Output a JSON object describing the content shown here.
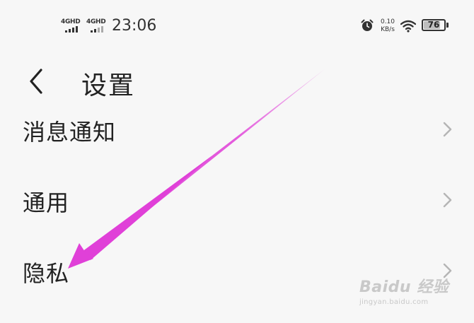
{
  "status_bar": {
    "signal_1_label": "4GHD",
    "signal_2_label": "4GHD",
    "time": "23:06",
    "net_speed_value": "0.10",
    "net_speed_unit": "KB/s",
    "battery_level": "76",
    "battery_fraction": 0.76,
    "icons": [
      "alarm-clock-icon",
      "wifi-icon",
      "battery-icon",
      "signal-icon"
    ]
  },
  "header": {
    "title": "设置",
    "back_icon": "chevron-left-icon"
  },
  "menu": {
    "items": [
      {
        "label": "消息通知",
        "icon": "chevron-right-icon"
      },
      {
        "label": "通用",
        "icon": "chevron-right-icon"
      },
      {
        "label": "隐私",
        "icon": "chevron-right-icon"
      }
    ]
  },
  "annotation": {
    "arrow_color": "#e040d8",
    "arrow_target": "隐私"
  },
  "watermark": {
    "main": "Baidu 经验",
    "sub": "jingyan.baidu.com"
  }
}
